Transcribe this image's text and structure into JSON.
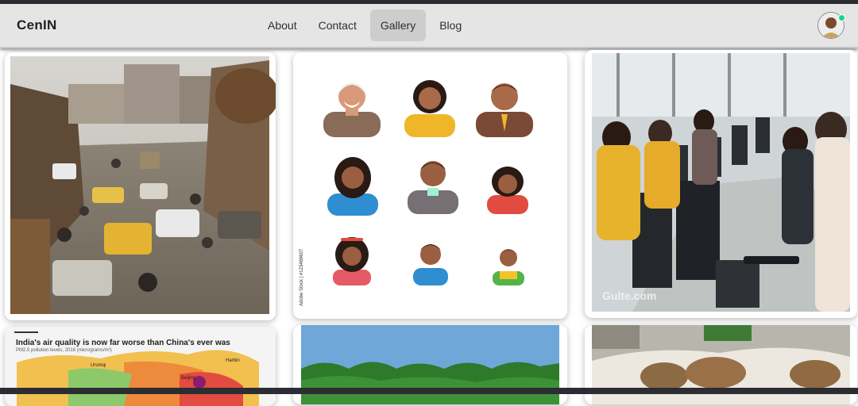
{
  "navbar": {
    "brand": "CenIN",
    "links": [
      {
        "label": "About",
        "active": false
      },
      {
        "label": "Contact",
        "active": false
      },
      {
        "label": "Gallery",
        "active": true
      },
      {
        "label": "Blog",
        "active": false
      }
    ]
  },
  "gallery": {
    "card_aqi": {
      "title": "India's air quality is now far worse than China's ever was",
      "subtitle": "PM2.5 pollution levels, 2016 (micrograms/m³)",
      "labels": [
        "Urumqi",
        "Harbin",
        "Beijing"
      ]
    },
    "card_avatars": {
      "watermark": "Adobe Stock | #123469607"
    },
    "card_office": {
      "watermark": "Gulte.com"
    }
  },
  "colors": {
    "accent_online": "#19d48c",
    "navbar_bg": "#e5e5e5",
    "active_tab": "#cdcdcd"
  }
}
